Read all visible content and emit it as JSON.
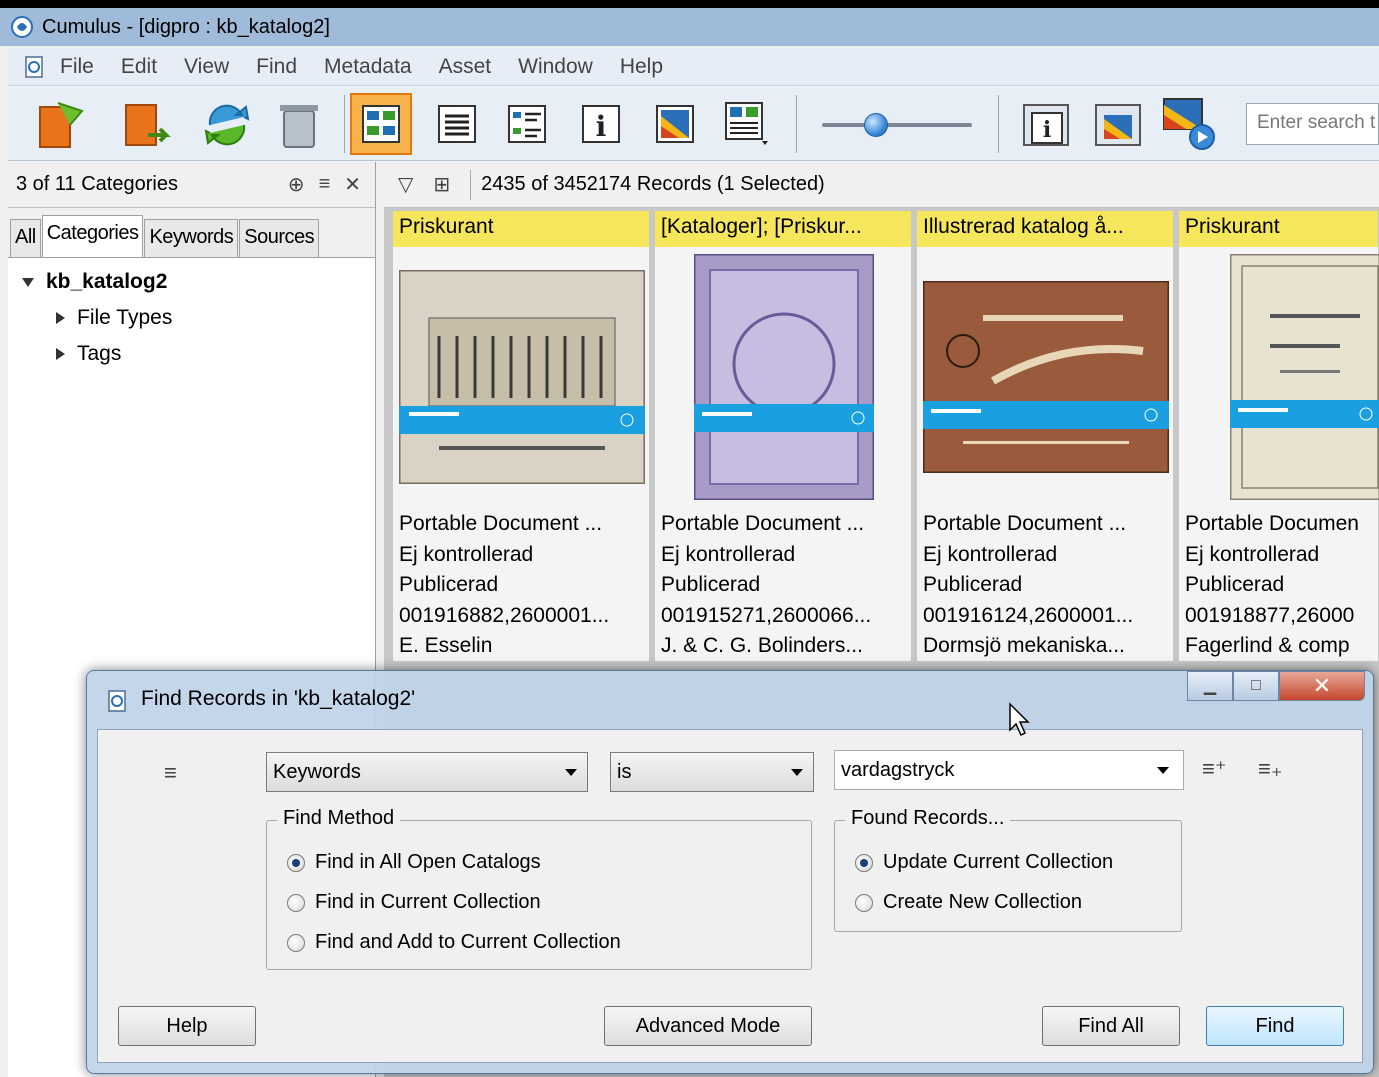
{
  "window": {
    "title": "Cumulus - [digpro : kb_katalog2]"
  },
  "menu": [
    "File",
    "Edit",
    "View",
    "Find",
    "Metadata",
    "Asset",
    "Window",
    "Help"
  ],
  "toolbar": {
    "search_placeholder": "Enter search t",
    "buttons": [
      "open-catalog-icon",
      "export-icon",
      "refresh-icon",
      "trash-icon",
      "thumbnail-view-icon",
      "list-view-icon",
      "details-view-icon",
      "info-icon",
      "preview-icon",
      "layout-icon",
      "info-window-icon",
      "preview-window-icon",
      "slideshow-icon"
    ]
  },
  "left_panel": {
    "count_label": "3 of 11 Categories",
    "tabs": [
      "All",
      "Categories",
      "Keywords",
      "Sources"
    ],
    "active_tab": "Categories",
    "tree": {
      "root": "kb_katalog2",
      "children": [
        "File Types",
        "Tags"
      ]
    }
  },
  "records": {
    "count_label": "2435 of 3452174 Records (1 Selected)",
    "cards": [
      {
        "title": "Priskurant",
        "type": "Portable Document ...",
        "status": "Ej kontrollerad",
        "pub": "Publicerad",
        "id": "001916882,2600001...",
        "author": " E. Esselin"
      },
      {
        "title": "[Kataloger]; [Priskur...",
        "type": "Portable Document ...",
        "status": "Ej kontrollerad",
        "pub": "Publicerad",
        "id": "001915271,2600066...",
        "author": " J. & C. G. Bolinders..."
      },
      {
        "title": "Illustrerad katalog å...",
        "type": "Portable Document ...",
        "status": "Ej kontrollerad",
        "pub": "Publicerad",
        "id": "001916124,2600001...",
        "author": " Dormsjö mekaniska..."
      },
      {
        "title": "Priskurant",
        "type": "Portable Documen",
        "status": "Ej kontrollerad",
        "pub": "Publicerad",
        "id": "001918877,26000",
        "author": " Fagerlind & comp"
      }
    ]
  },
  "dialog": {
    "title": "Find Records in 'kb_katalog2'",
    "field": "Keywords",
    "operator": "is",
    "value": "vardagstryck",
    "find_method": {
      "legend": "Find Method",
      "options": [
        "Find in All Open Catalogs",
        "Find in Current Collection",
        "Find and Add to Current Collection"
      ],
      "selected": 0
    },
    "found_records": {
      "legend": "Found Records...",
      "options": [
        "Update Current Collection",
        "Create New Collection"
      ],
      "selected": 0
    },
    "buttons": {
      "help": "Help",
      "advanced": "Advanced Mode",
      "find_all": "Find All",
      "find": "Find"
    }
  },
  "colors": {
    "title_bar": "#9fbbd9",
    "card_title": "#f5e65c",
    "active_tool": "#f6b34b",
    "close_button": "#c6462e"
  }
}
